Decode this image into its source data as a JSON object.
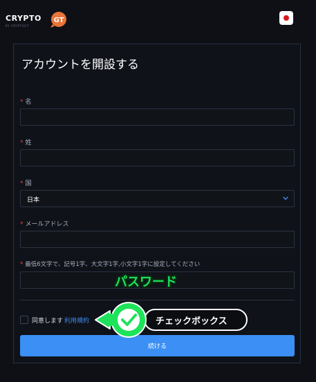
{
  "header": {
    "logo_text": "CRYPTO",
    "logo_badge": "GT",
    "logo_sub": "BY CRYPTOGT",
    "language_flag": "jp-flag"
  },
  "form": {
    "title": "アカウントを開設する",
    "first_name_label": "名",
    "first_name_value": "",
    "last_name_label": "姓",
    "last_name_value": "",
    "country_label": "国",
    "country_value": "日本",
    "email_label": "メールアドレス",
    "email_value": "",
    "password_label": "最低6文字で、記号1字、大文字1字,小文字1字に設定してください",
    "password_value": "",
    "agree_text": "同意します",
    "terms_link": "利用規約",
    "continue_label": "続ける",
    "required_mark": "*"
  },
  "annotations": {
    "password": "パスワード",
    "checkbox": "チェックボックス"
  },
  "colors": {
    "background": "#0e1016",
    "panel_border": "#283241",
    "accent": "#3b8ff5",
    "link": "#3e8bf5",
    "annotation_green": "#1ee35a",
    "required": "#e44545"
  }
}
